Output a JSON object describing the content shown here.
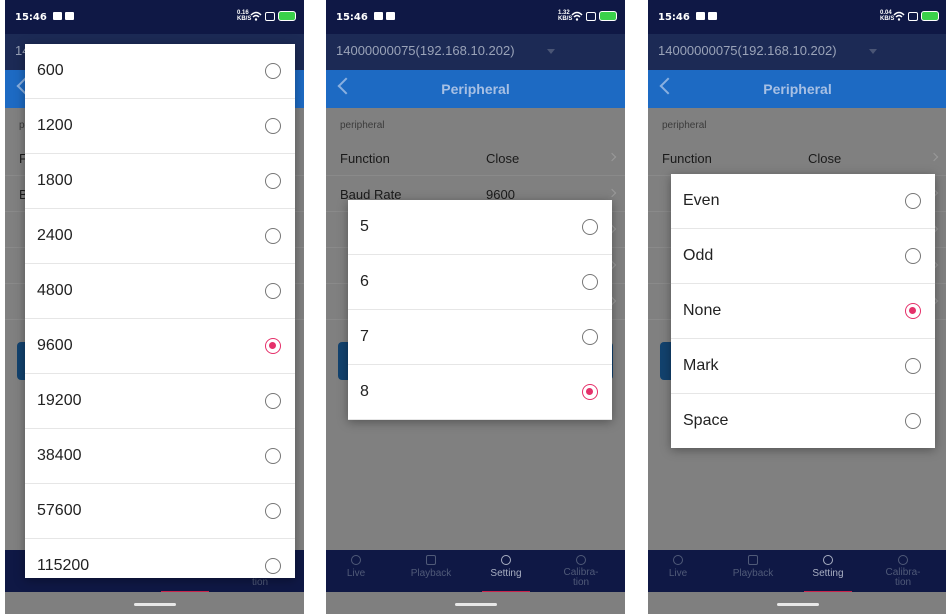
{
  "status": {
    "time": "15:46",
    "net_speed_1": "0.16\nKB/S",
    "net_speed_2": "1.32\nKB/S",
    "net_speed_3": "0.04\nKB/S"
  },
  "device": {
    "label": "14000000075(192.168.10.202)"
  },
  "page": {
    "title": "Peripheral",
    "section": "peripheral"
  },
  "settings": {
    "function": {
      "label": "Function",
      "value": "Close"
    },
    "baud": {
      "label": "Baud Rate",
      "value": "9600"
    }
  },
  "nav": {
    "live": "Live",
    "playback": "Playback",
    "setting": "Setting",
    "calibration": "Calibra-\ntion"
  },
  "baud_options": [
    {
      "label": "600",
      "selected": false
    },
    {
      "label": "1200",
      "selected": false
    },
    {
      "label": "1800",
      "selected": false
    },
    {
      "label": "2400",
      "selected": false
    },
    {
      "label": "4800",
      "selected": false
    },
    {
      "label": "9600",
      "selected": true
    },
    {
      "label": "19200",
      "selected": false
    },
    {
      "label": "38400",
      "selected": false
    },
    {
      "label": "57600",
      "selected": false
    },
    {
      "label": "115200",
      "selected": false
    }
  ],
  "databit_options": [
    {
      "label": "5",
      "selected": false
    },
    {
      "label": "6",
      "selected": false
    },
    {
      "label": "7",
      "selected": false
    },
    {
      "label": "8",
      "selected": true
    }
  ],
  "parity_options": [
    {
      "label": "Even",
      "selected": false
    },
    {
      "label": "Odd",
      "selected": false
    },
    {
      "label": "None",
      "selected": true
    },
    {
      "label": "Mark",
      "selected": false
    },
    {
      "label": "Space",
      "selected": false
    }
  ],
  "colors": {
    "accent": "#e5306a",
    "header": "#1d6ac3",
    "statusbar": "#0f1845"
  }
}
